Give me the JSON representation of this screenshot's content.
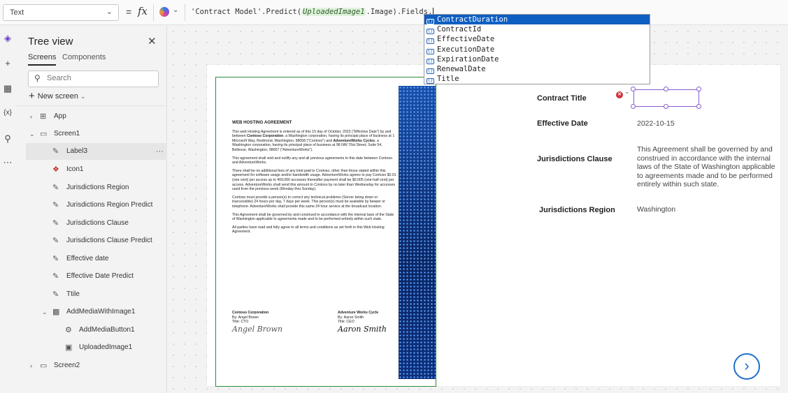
{
  "formula_bar": {
    "property": "Text",
    "equals": "=",
    "fx": "fx",
    "formula_prefix": "'Contract Model'.Predict(",
    "formula_highlight": "UploadedImage1",
    "formula_suffix": ".Image).Fields."
  },
  "autocomplete": {
    "items": [
      "ContractDuration",
      "ContractId",
      "EffectiveDate",
      "ExecutionDate",
      "ExpirationDate",
      "RenewalDate",
      "Title"
    ],
    "selected_index": 0
  },
  "tree": {
    "title": "Tree view",
    "tabs": [
      "Screens",
      "Components"
    ],
    "search_placeholder": "Search",
    "new_screen": "New screen",
    "items": [
      {
        "label": "App"
      },
      {
        "label": "Screen1"
      },
      {
        "label": "Label3"
      },
      {
        "label": "Icon1"
      },
      {
        "label": "Jurisdictions Region"
      },
      {
        "label": "Jurisdictions Region Predict"
      },
      {
        "label": "Jurisdictions Clause"
      },
      {
        "label": "Jurisdictions Clause Predict"
      },
      {
        "label": "Effective date"
      },
      {
        "label": "Effective Date Predict"
      },
      {
        "label": "Ttile"
      },
      {
        "label": "AddMediaWithImage1"
      },
      {
        "label": "AddMediaButton1"
      },
      {
        "label": "UploadedImage1"
      },
      {
        "label": "Screen2"
      }
    ],
    "more": "···"
  },
  "document": {
    "title": "WEB HOSTING AGREEMENT",
    "p1a": "This web Hosting Agreement is entered as of this 15 day of October, 2022 (\"Effective Date\") by and between ",
    "p1b": "Contoso Corporation",
    "p1c": ", a Washington corporation, having its principal place of business at 1 Microsoft Way, Redmond, Washington, 98058 (\"Contoso\") and ",
    "p1d": "AdventureWorks Cycles",
    "p1e": ", a Washington corporation, having its principal place of business at 98 NW 76st Street, Suite 54, Bellevue, Washington, 98007 (\"AdventureWorks\").",
    "p2": "This agreement shall void and nullify any and all previous agreements to this date between Contoso and AdventureWorks.",
    "p3": "There shall be no additional fees of any kind paid to Contoso, other than those stated within this agreement for software usage and/or bandwidth usage. AdventureWorks agrees to pay Contoso $0.01 (one cent) per access up to 400,000 accesses thereafter payment shall be $0.005 (one-half cent) per access. AdventureWorks shall send this amount to Contoso by no later than Wednesday for accesses used from the previous week (Monday thru Sunday).",
    "p4": "Contoso must provide a person(s) to correct any technical problems (Server being down or inaccessible) 24 hours per day, 7 days per week. This person(s) must be available by beeper or telephone. AdventureWorks shall provide this same 24 hour service at the broadcast location.",
    "p5": "This Agreement shall be governed by and construed in accordance with the internal laws of the State of Washington applicable to agreements made and to be performed entirely within such state.",
    "p6": "All parties have read and fully agree to all terms and conditions as set forth in this Web Hosting Agreement.",
    "sig_left": {
      "company": "Contoso Corporation",
      "by": "By: Angel Brown",
      "title": "Title: CTO",
      "signature": "Angel Brown"
    },
    "sig_right": {
      "company": "Adventure Works Cycle",
      "by": "By: Aaron Smith",
      "title": "Title: CEO",
      "signature": "Aaron Smith"
    }
  },
  "fields": {
    "contract_title_label": "Contract Title",
    "effective_date_label": "Effective Date",
    "effective_date_value": "2022-10-15",
    "jurisdictions_clause_label": "Jurisdictions Clause",
    "jurisdictions_clause_value": "This Agreement shall be governed by and construed in accordance with the internal laws of the State of Washington applicable to agreements made and to be performed entirely within such state.",
    "jurisdictions_region_label": "Jurisdictions Region",
    "jurisdictions_region_value": "Washington"
  },
  "colors": {
    "accent": "#0e5fc2",
    "selection": "#8a5bd0",
    "error": "#d13438",
    "image_border": "#2d8a3d"
  }
}
